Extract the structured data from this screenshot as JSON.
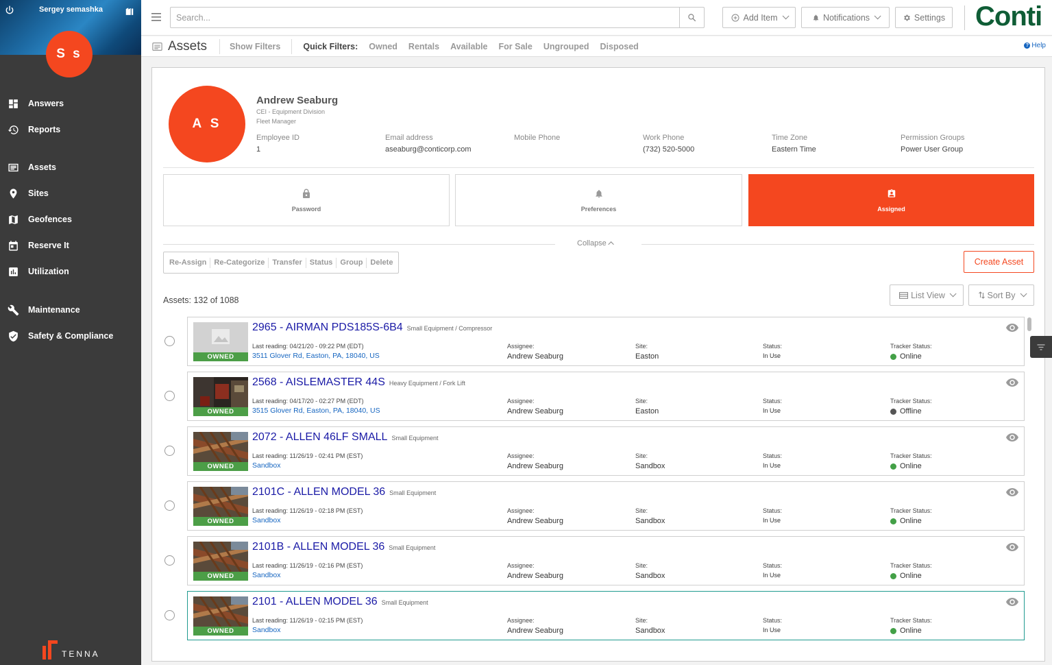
{
  "user": {
    "name": "Sergey semashka",
    "initials": "S s"
  },
  "nav": [
    {
      "label": "Answers",
      "icon": "dashboard-icon"
    },
    {
      "label": "Reports",
      "icon": "history-icon"
    },
    {
      "label": "Assets",
      "icon": "list-icon"
    },
    {
      "label": "Sites",
      "icon": "location-pin-icon"
    },
    {
      "label": "Geofences",
      "icon": "map-icon"
    },
    {
      "label": "Reserve It",
      "icon": "calendar-icon"
    },
    {
      "label": "Utilization",
      "icon": "bar-chart-icon"
    },
    {
      "label": "Maintenance",
      "icon": "wrench-icon"
    },
    {
      "label": "Safety & Compliance",
      "icon": "shield-icon"
    }
  ],
  "footer_brand": "TENNA",
  "topbar": {
    "search_placeholder": "Search...",
    "add_item": "Add Item",
    "notifications": "Notifications",
    "settings": "Settings",
    "brand": "Conti"
  },
  "subbar": {
    "title": "Assets",
    "show_filters": "Show Filters",
    "quick_filters_label": "Quick Filters:",
    "quick_filters": [
      "Owned",
      "Rentals",
      "Available",
      "For Sale",
      "Ungrouped",
      "Disposed"
    ],
    "help": "Help"
  },
  "profile": {
    "initials": "A S",
    "name": "Andrew Seaburg",
    "division": "CEI - Equipment Division",
    "role": "Fleet Manager",
    "fields": [
      {
        "label": "Employee ID",
        "value": "1"
      },
      {
        "label": "Email address",
        "value": "aseaburg@conticorp.com"
      },
      {
        "label": "Mobile Phone",
        "value": ""
      },
      {
        "label": "Work Phone",
        "value": "(732) 520-5000"
      },
      {
        "label": "Time Zone",
        "value": "Eastern Time"
      },
      {
        "label": "Permission Groups",
        "value": "Power User Group"
      }
    ]
  },
  "cards": [
    {
      "label": "Password",
      "icon": "lock-icon",
      "active": false
    },
    {
      "label": "Preferences",
      "icon": "bell-icon",
      "active": false
    },
    {
      "label": "Assigned",
      "icon": "assignment-ind-icon",
      "active": true
    }
  ],
  "collapse_label": "Collapse",
  "actions": [
    "Re-Assign",
    "Re-Categorize",
    "Transfer",
    "Status",
    "Group",
    "Delete"
  ],
  "create_asset": "Create Asset",
  "asset_count": "Assets: 132 of 1088",
  "list_view": "List View",
  "sort_by": "Sort By",
  "labels": {
    "assignee": "Assignee:",
    "site": "Site:",
    "status": "Status:",
    "tracker_status": "Tracker Status:",
    "owned": "OWNED"
  },
  "assets": [
    {
      "title": "2965 - AIRMAN PDS185S-6B4",
      "category": "Small Equipment / Compressor",
      "reading": "Last reading: 04/21/20 - 09:22 PM (EDT)",
      "address": "3511 Glover Rd, Easton, PA, 18040, US",
      "assignee": "Andrew Seaburg",
      "site": "Easton",
      "status": "In Use",
      "tracker": "Online",
      "tracker_color": "#43a047",
      "thumb": "placeholder"
    },
    {
      "title": "2568 - AISLEMASTER 44S",
      "category": "Heavy Equipment / Fork Lift",
      "reading": "Last reading: 04/17/20 - 02:27 PM (EDT)",
      "address": "3515 Glover Rd, Easton, PA, 18040, US",
      "assignee": "Andrew Seaburg",
      "site": "Easton",
      "status": "In Use",
      "tracker": "Offline",
      "tracker_color": "#555555",
      "thumb": "forklift"
    },
    {
      "title": "2072 - ALLEN 46LF SMALL",
      "category": "Small Equipment",
      "reading": "Last reading: 11/26/19 - 02:41 PM (EST)",
      "address": "Sandbox",
      "assignee": "Andrew Seaburg",
      "site": "Sandbox",
      "status": "In Use",
      "tracker": "Online",
      "tracker_color": "#43a047",
      "thumb": "rebar"
    },
    {
      "title": "2101C - ALLEN MODEL 36",
      "category": "Small Equipment",
      "reading": "Last reading: 11/26/19 - 02:18 PM (EST)",
      "address": "Sandbox",
      "assignee": "Andrew Seaburg",
      "site": "Sandbox",
      "status": "In Use",
      "tracker": "Online",
      "tracker_color": "#43a047",
      "thumb": "rebar"
    },
    {
      "title": "2101B - ALLEN MODEL 36",
      "category": "Small Equipment",
      "reading": "Last reading: 11/26/19 - 02:16 PM (EST)",
      "address": "Sandbox",
      "assignee": "Andrew Seaburg",
      "site": "Sandbox",
      "status": "In Use",
      "tracker": "Online",
      "tracker_color": "#43a047",
      "thumb": "rebar"
    },
    {
      "title": "2101 - ALLEN MODEL 36",
      "category": "Small Equipment",
      "reading": "Last reading: 11/26/19 - 02:15 PM (EST)",
      "address": "Sandbox",
      "assignee": "Andrew Seaburg",
      "site": "Sandbox",
      "status": "In Use",
      "tracker": "Online",
      "tracker_color": "#43a047",
      "thumb": "rebar"
    }
  ]
}
